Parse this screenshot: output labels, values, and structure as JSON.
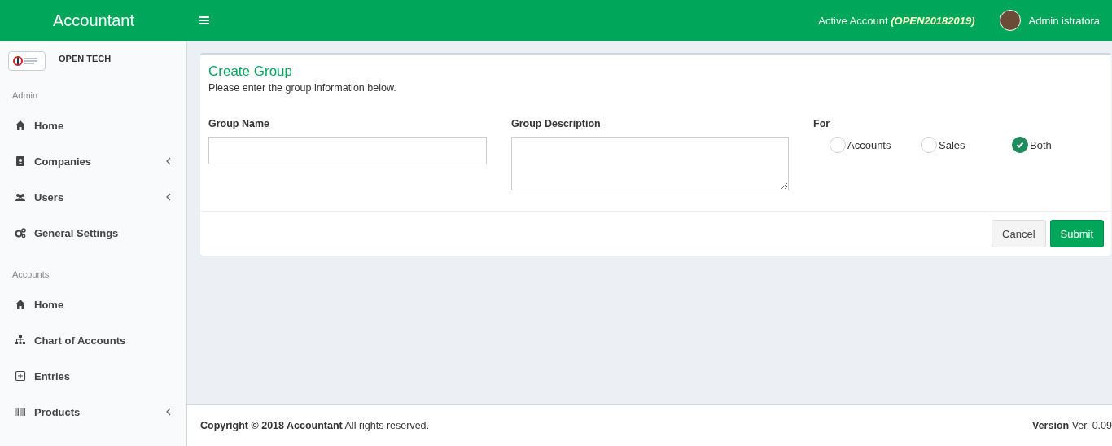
{
  "header": {
    "brand": "Accountant",
    "active_account_label": "Active Account",
    "active_account": "(OPEN20182019)",
    "user_name": "Admin istratora"
  },
  "sidebar": {
    "company": "OPEN TECH",
    "sections": [
      {
        "title": "Admin",
        "items": [
          {
            "label": "Home",
            "expandable": false
          },
          {
            "label": "Companies",
            "expandable": true
          },
          {
            "label": "Users",
            "expandable": true
          },
          {
            "label": "General Settings",
            "expandable": false
          }
        ]
      },
      {
        "title": "Accounts",
        "items": [
          {
            "label": "Home",
            "expandable": false
          },
          {
            "label": "Chart of Accounts",
            "expandable": false
          },
          {
            "label": "Entries",
            "expandable": false
          },
          {
            "label": "Products",
            "expandable": true
          }
        ]
      }
    ]
  },
  "form": {
    "title": "Create Group",
    "subtitle": "Please enter the group information below.",
    "group_name": {
      "label": "Group Name"
    },
    "group_description": {
      "label": "Group Description"
    },
    "for": {
      "label": "For",
      "options": [
        {
          "label": "Accounts",
          "selected": false
        },
        {
          "label": "Sales",
          "selected": false
        },
        {
          "label": "Both",
          "selected": true
        }
      ]
    },
    "buttons": [
      {
        "label": "Cancel",
        "kind": "default"
      },
      {
        "label": "Submit",
        "kind": "primary"
      }
    ]
  },
  "footer": {
    "copyright": "**Copyright © 2018 Accountant** All rights reserved.",
    "version": "**Version** Ver. 0.09"
  }
}
